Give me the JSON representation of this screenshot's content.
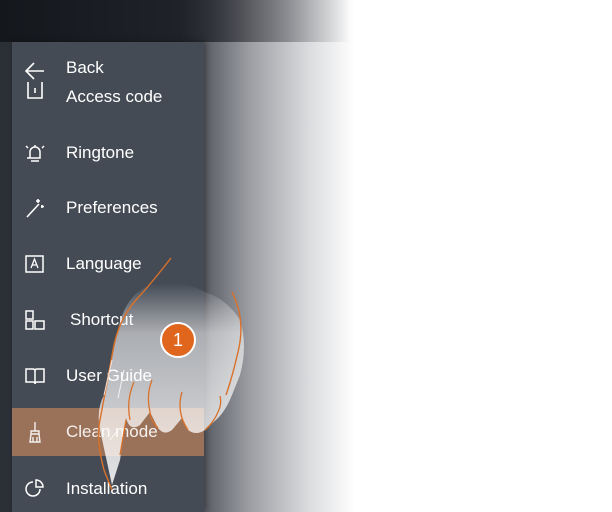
{
  "menu": {
    "back_label": "Back",
    "items": [
      {
        "label": "Access code",
        "icon": "access-code-icon"
      },
      {
        "label": "Ringtone",
        "icon": "bell-icon"
      },
      {
        "label": "Preferences",
        "icon": "wand-icon"
      },
      {
        "label": "Language",
        "icon": "language-icon"
      },
      {
        "label": "Shortcut",
        "icon": "shortcut-icon"
      },
      {
        "label": "User Guide",
        "icon": "book-icon"
      },
      {
        "label": "Clean mode",
        "icon": "brush-icon"
      },
      {
        "label": "Installation",
        "icon": "installation-icon"
      }
    ],
    "active_item": "Clean mode"
  },
  "callout": {
    "number": "1"
  },
  "colors": {
    "panel": "#454b55",
    "active_row": "#9a7159",
    "callout": "#e0661e",
    "hand_outline": "#d9712a"
  }
}
